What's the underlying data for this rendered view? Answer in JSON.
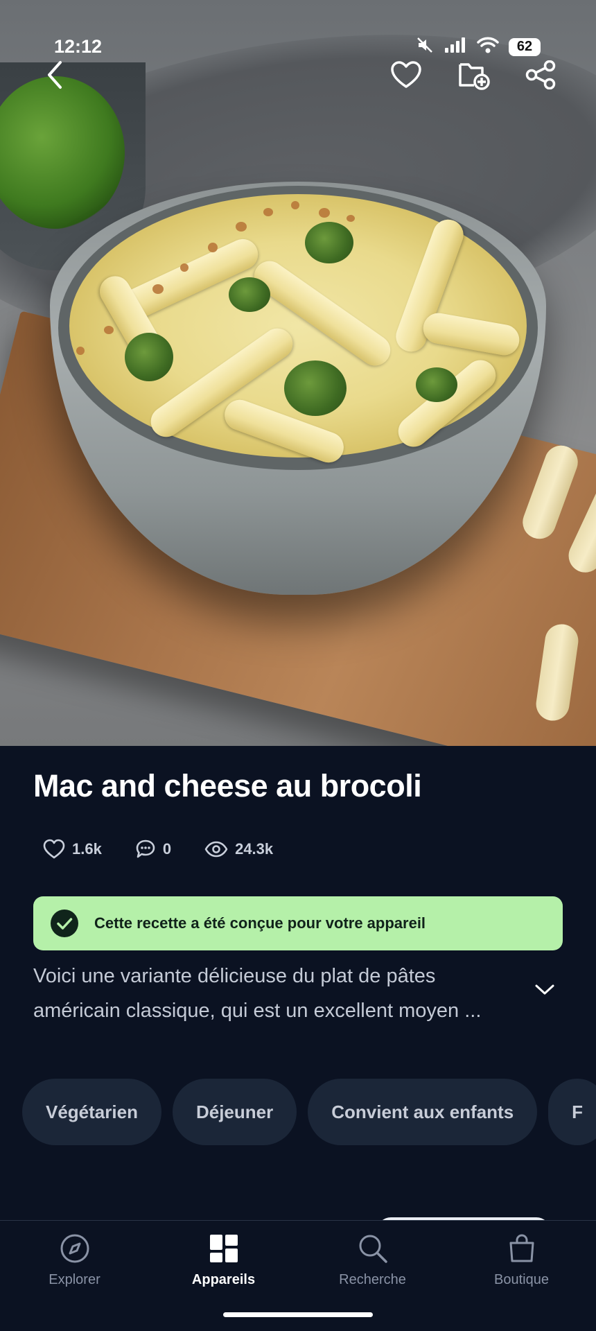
{
  "status_bar": {
    "time": "12:12",
    "battery": "62"
  },
  "recipe": {
    "title": "Mac and cheese au brocoli",
    "stats": {
      "likes": "1.6k",
      "comments": "0",
      "views": "24.3k"
    },
    "compatibility_banner": "Cette recette a été conçue pour votre appareil",
    "description_line1": "Voici une variante délicieuse du plat de pâtes",
    "description_line2": "américain classique, qui est un excellent moyen ...",
    "tags": [
      "Végétarien",
      "Déjeuner",
      "Convient aux enfants",
      "F"
    ]
  },
  "bottom_nav": {
    "items": [
      {
        "label": "Explorer",
        "icon": "compass-icon",
        "active": false
      },
      {
        "label": "Appareils",
        "icon": "appliances-grid-icon",
        "active": true
      },
      {
        "label": "Recherche",
        "icon": "search-icon",
        "active": false
      },
      {
        "label": "Boutique",
        "icon": "shopping-bag-icon",
        "active": false
      }
    ]
  },
  "colors": {
    "background": "#0b1222",
    "banner": "#b5f0a9",
    "chip": "#1b2638",
    "text_primary": "#ffffff",
    "text_secondary": "#c4cad6",
    "nav_inactive": "#8a93a6"
  }
}
